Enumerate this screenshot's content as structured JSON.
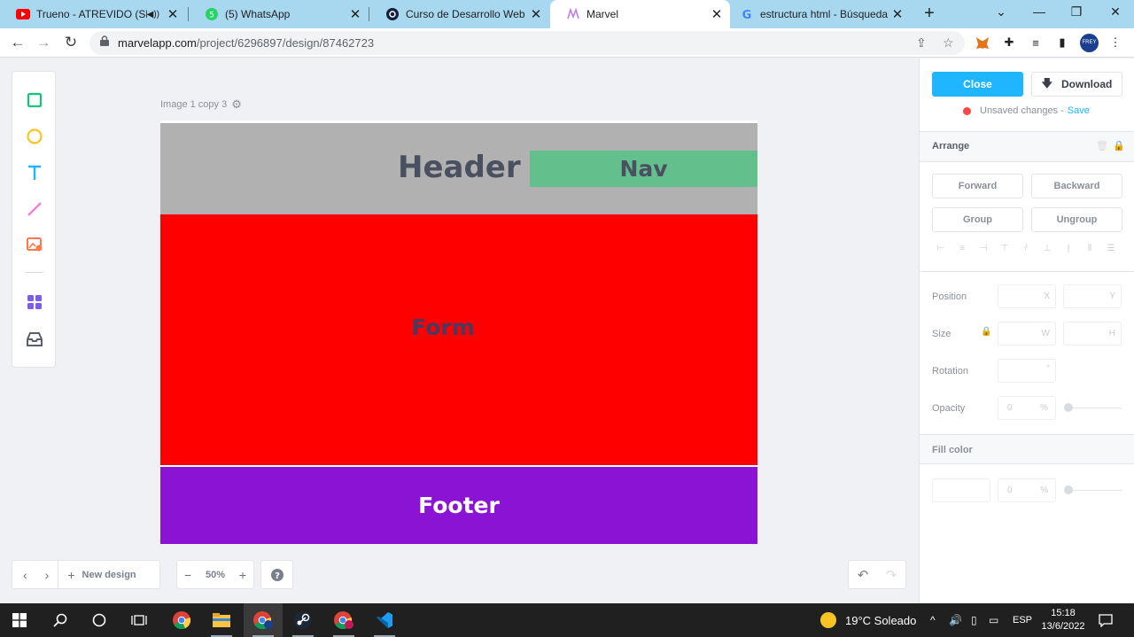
{
  "browser": {
    "tabs": [
      {
        "title": "Trueno - ATREVIDO (Shot",
        "icon": "youtube-icon",
        "audio": true,
        "active": false
      },
      {
        "title": "(5) WhatsApp",
        "icon": "whatsapp-icon",
        "active": false
      },
      {
        "title": "Curso de Desarrollo Web | Pl",
        "icon": "platzi-icon",
        "active": false
      },
      {
        "title": "Marvel",
        "icon": "marvel-icon",
        "active": true
      },
      {
        "title": "estructura html - Búsqueda d",
        "icon": "google-icon",
        "active": false
      }
    ],
    "url_host": "marvelapp.com",
    "url_path": "/project/6296897/design/87462723",
    "profile_initials": "FREY"
  },
  "editor": {
    "canvas_label": "Image 1 copy 3",
    "blocks": {
      "header": "Header",
      "nav": "Nav",
      "form": "Form",
      "footer": "Footer"
    },
    "colors": {
      "header": "#b1b1b1",
      "nav": "#63bf8c",
      "form": "#ff0000",
      "footer": "#8a13d4"
    },
    "bottom": {
      "new_design": "New design",
      "zoom": "50%",
      "help": "?"
    }
  },
  "panel": {
    "close": "Close",
    "download": "Download",
    "unsaved": "Unsaved changes -",
    "save": "Save",
    "arrange": "Arrange",
    "forward": "Forward",
    "backward": "Backward",
    "group": "Group",
    "ungroup": "Ungroup",
    "position": "Position",
    "x_ph": "X",
    "y_ph": "Y",
    "size": "Size",
    "w_ph": "W",
    "h_ph": "H",
    "rotation": "Rotation",
    "rotation_unit": "°",
    "opacity": "Opacity",
    "opacity_value": "0",
    "pct": "%",
    "fill_color": "Fill color",
    "fill_value": "0"
  },
  "taskbar": {
    "weather": "19°C  Soleado",
    "lang": "ESP",
    "time": "15:18",
    "date": "13/6/2022"
  }
}
